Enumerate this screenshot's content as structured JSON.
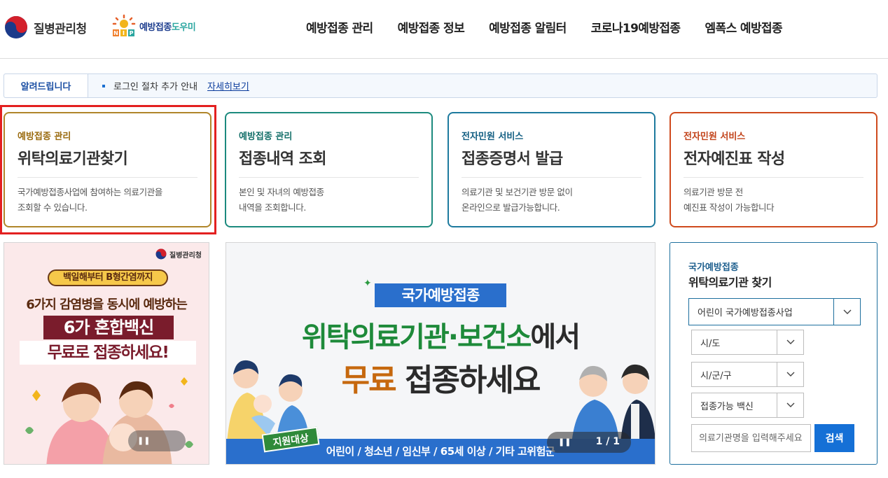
{
  "header": {
    "org_name": "질병관리청",
    "nip_logo_text_a": "예방접종",
    "nip_logo_text_b": "도우미",
    "nav": [
      "예방접종 관리",
      "예방접종 정보",
      "예방접종 알림터",
      "코로나19예방접종",
      "엠폭스 예방접종"
    ]
  },
  "notice": {
    "tag": "알려드립니다",
    "message": "로그인 절차 추가 안내",
    "more": "자세히보기"
  },
  "cards": [
    {
      "category": "예방접종 관리",
      "title": "위탁의료기관찾기",
      "desc1": "국가예방접종사업에 참여하는 의료기관을",
      "desc2": "조회할 수 있습니다."
    },
    {
      "category": "예방접종 관리",
      "title": "접종내역 조회",
      "desc1": "본인 및 자녀의 예방접종",
      "desc2": "내역을 조회합니다."
    },
    {
      "category": "전자민원 서비스",
      "title": "접종증명서 발급",
      "desc1": "의료기관 및 보건기관 방문 없이",
      "desc2": "온라인으로 발급가능합니다."
    },
    {
      "category": "전자민원 서비스",
      "title": "전자예진표 작성",
      "desc1": "의료기관 방문 전",
      "desc2": "예진표 작성이 가능합니다"
    }
  ],
  "banner_left": {
    "org": "질병관리청",
    "pill": "백일해부터 B형간염까지",
    "line1": "6가지 감염병을 동시에 예방하는",
    "line2": "6가 혼합백신",
    "line3": "무료로 접종하세요!",
    "pause": "❚❚"
  },
  "banner_mid": {
    "badge": "국가예방접종",
    "line1_green": "위탁의료기관·보건소",
    "line1_dark": "에서",
    "line2_orange": "무료",
    "line2_dark": " 접종하세요",
    "support": "지원대상",
    "strip": "어린이 / 청소년 / 임신부 / 65세 이상 / 기타 고위험군",
    "pause": "❚❚",
    "counter": "1 / 1"
  },
  "search": {
    "category": "국가예방접종",
    "title": "위탁의료기관 찾기",
    "program": "어린이 국가예방접종사업",
    "sido": "시/도",
    "sigungu": "시/군/구",
    "vaccine": "접종가능 백신",
    "placeholder": "의료기관명을 입력해주세요",
    "button": "검색"
  },
  "colors": {
    "accent_blue": "#1570d6",
    "highlight_red": "#e32020",
    "green": "#1e8a3a",
    "orange": "#c6680e"
  }
}
